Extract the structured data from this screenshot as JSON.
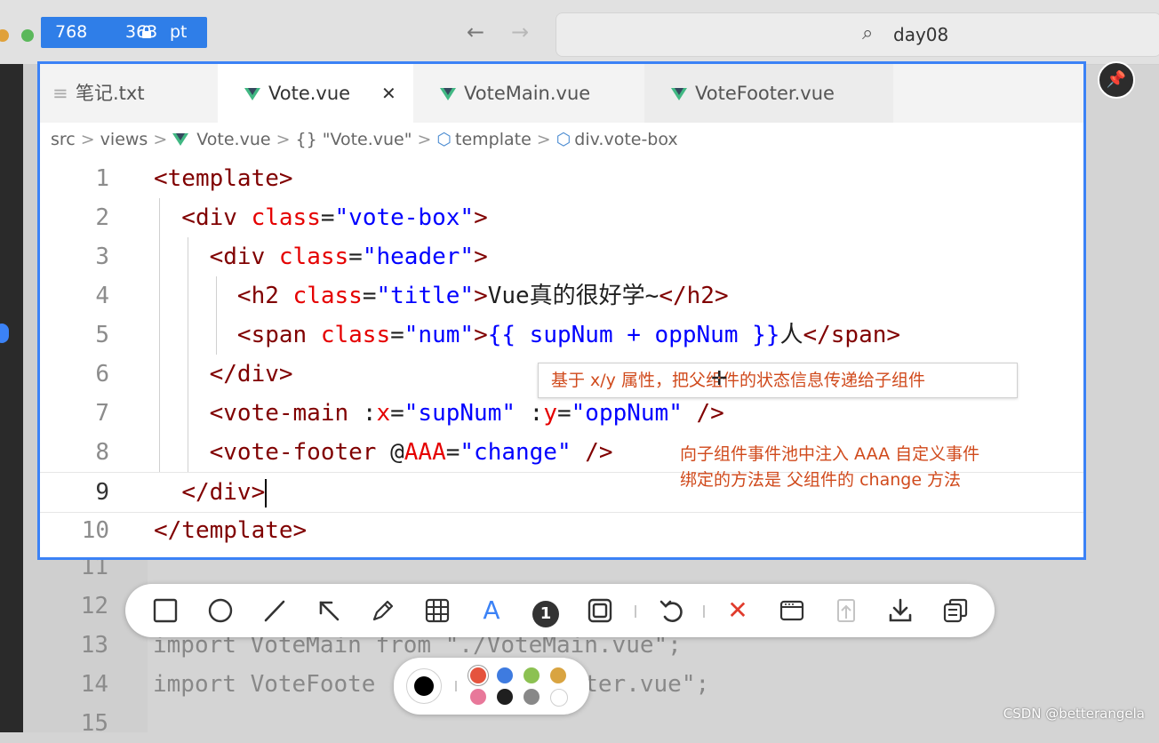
{
  "dimension_badge": {
    "width": "768",
    "height": "363",
    "unit": "pt"
  },
  "titlebar": {
    "back_glyph": "←",
    "forward_glyph": "→",
    "search_text": "day08",
    "search_glyph": "⌕"
  },
  "editor": {
    "tabs": [
      {
        "label": "笔记.txt",
        "icon": "text-file-icon",
        "icon_glyph": "≡"
      },
      {
        "label": "Vote.vue",
        "icon": "vue-icon",
        "close_glyph": "✕"
      },
      {
        "label": "VoteMain.vue",
        "icon": "vue-icon"
      },
      {
        "label": "VoteFooter.vue",
        "icon": "vue-icon"
      }
    ],
    "breadcrumb": [
      "src",
      "views",
      "Vote.vue",
      "{} \"Vote.vue\"",
      "template",
      "div.vote-box"
    ],
    "breadcrumb_sep": ">",
    "cube_glyph": "⬡",
    "lines": [
      {
        "num": "1",
        "tokens": [
          [
            "tag",
            "<template>"
          ]
        ]
      },
      {
        "num": "2",
        "tokens": [
          [
            "tag",
            "  <div "
          ],
          [
            "attr",
            "class"
          ],
          [
            "plain",
            "="
          ],
          [
            "val",
            "\"vote-box\""
          ],
          [
            "tag",
            ">"
          ]
        ]
      },
      {
        "num": "3",
        "tokens": [
          [
            "tag",
            "    <div "
          ],
          [
            "attr",
            "class"
          ],
          [
            "plain",
            "="
          ],
          [
            "val",
            "\"header\""
          ],
          [
            "tag",
            ">"
          ]
        ]
      },
      {
        "num": "4",
        "tokens": [
          [
            "tag",
            "      <h2 "
          ],
          [
            "attr",
            "class"
          ],
          [
            "plain",
            "="
          ],
          [
            "val",
            "\"title\""
          ],
          [
            "tag",
            ">"
          ],
          [
            "plain",
            "Vue真的很好学~"
          ],
          [
            "tag",
            "</h2>"
          ]
        ]
      },
      {
        "num": "5",
        "tokens": [
          [
            "tag",
            "      <span "
          ],
          [
            "attr",
            "class"
          ],
          [
            "plain",
            "="
          ],
          [
            "val",
            "\"num\""
          ],
          [
            "tag",
            ">"
          ],
          [
            "val",
            "{{ supNum + oppNum }}"
          ],
          [
            "plain",
            "人"
          ],
          [
            "tag",
            "</span>"
          ]
        ]
      },
      {
        "num": "6",
        "tokens": [
          [
            "tag",
            "    </div>"
          ]
        ]
      },
      {
        "num": "7",
        "tokens": [
          [
            "tag",
            "    <vote-main "
          ],
          [
            "plain",
            ":"
          ],
          [
            "attr",
            "x"
          ],
          [
            "plain",
            "="
          ],
          [
            "val",
            "\"supNum\""
          ],
          [
            "plain",
            " :"
          ],
          [
            "attr",
            "y"
          ],
          [
            "plain",
            "="
          ],
          [
            "val",
            "\"oppNum\""
          ],
          [
            "tag",
            " />"
          ]
        ]
      },
      {
        "num": "8",
        "tokens": [
          [
            "tag",
            "    <vote-footer "
          ],
          [
            "plain",
            "@"
          ],
          [
            "attr",
            "AAA"
          ],
          [
            "plain",
            "="
          ],
          [
            "val",
            "\"change\""
          ],
          [
            "tag",
            " />"
          ]
        ]
      },
      {
        "num": "9",
        "tokens": []
      },
      {
        "num": "10",
        "tokens": [
          [
            "tag",
            "</template>"
          ]
        ]
      }
    ],
    "line9": {
      "indent": "  ",
      "text": "</div>"
    }
  },
  "background_code": [
    {
      "num": "11",
      "text": ""
    },
    {
      "num": "12",
      "text": ""
    },
    {
      "num": "13",
      "text": "import VoteMain from \"./VoteMain.vue\";"
    },
    {
      "num": "14",
      "text": "import VoteFoote          teFooter.vue\";"
    },
    {
      "num": "15",
      "text": ""
    }
  ],
  "annotations": {
    "box_text": "基于 x/y 属性，把父组件的状态信息传递给子组件",
    "note_line1": "向子组件事件池中注入 AAA 自定义事件",
    "note_line2": "绑定的方法是 父组件的 change 方法"
  },
  "toolbar_tools": [
    {
      "name": "rectangle-tool-button",
      "icon": "rectangle-icon"
    },
    {
      "name": "ellipse-tool-button",
      "icon": "circle-icon"
    },
    {
      "name": "line-tool-button",
      "icon": "line-icon"
    },
    {
      "name": "arrow-tool-button",
      "icon": "arrow-icon"
    },
    {
      "name": "pen-tool-button",
      "icon": "pencil-icon"
    },
    {
      "name": "mosaic-tool-button",
      "icon": "mosaic-grid-icon"
    },
    {
      "name": "text-tool-button",
      "icon": "text-icon",
      "glyph": "A",
      "active": true
    },
    {
      "name": "number-marker-button",
      "icon": "number-marker-icon",
      "glyph": "1"
    },
    {
      "name": "highlight-tool-button",
      "icon": "highlight-box-icon"
    },
    {
      "name": "undo-button",
      "icon": "undo-icon"
    },
    {
      "name": "cancel-button",
      "icon": "close-icon",
      "glyph": "✕"
    },
    {
      "name": "window-capture-button",
      "icon": "window-icon"
    },
    {
      "name": "pin-button",
      "icon": "pin-to-screen-icon",
      "disabled": true
    },
    {
      "name": "download-button",
      "icon": "download-icon"
    },
    {
      "name": "copy-button",
      "icon": "copy-icon"
    }
  ],
  "palette": {
    "selected": "#000000",
    "swatches": [
      "#e5533d",
      "#3e7be0",
      "#8cc152",
      "#d9a441",
      "#e8789a",
      "#1f1f1f",
      "#888888",
      "#ffffff"
    ]
  },
  "pin_glyph": "📌",
  "watermark": "CSDN @betterangela"
}
